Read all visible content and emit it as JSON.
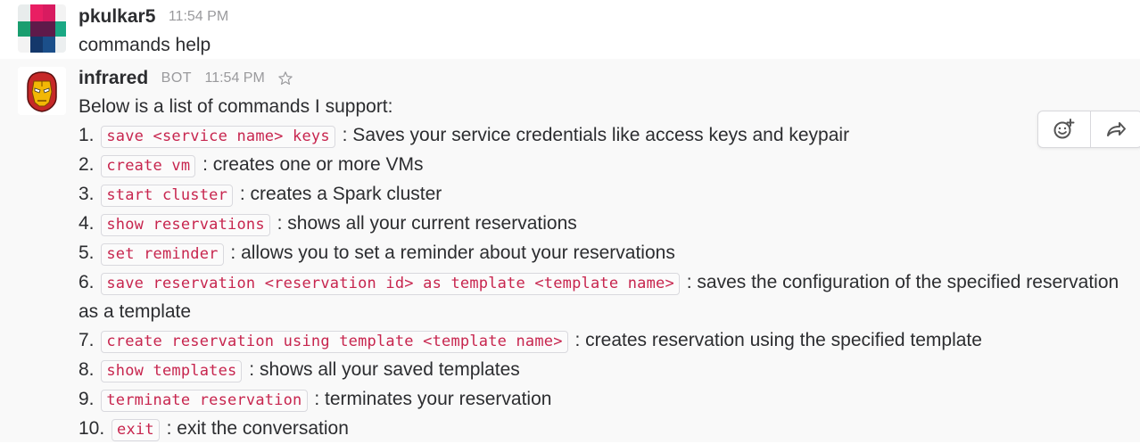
{
  "messages": [
    {
      "sender": "pkulkar5",
      "time": "11:54 PM",
      "text": "commands help",
      "avatar_icon": "colorful-grid-avatar"
    },
    {
      "sender": "infrared",
      "bot_label": "BOT",
      "time": "11:54 PM",
      "avatar_icon": "iron-man-avatar",
      "intro": "Below is a list of commands I support:",
      "commands": [
        {
          "num": "1.",
          "code": "save <service name> keys",
          "desc": ": Saves your service credentials like access keys and keypair"
        },
        {
          "num": "2.",
          "code": "create vm",
          "desc": ": creates one or more VMs"
        },
        {
          "num": "3.",
          "code": "start cluster",
          "desc": ": creates a Spark cluster"
        },
        {
          "num": "4.",
          "code": "show reservations",
          "desc": ": shows all your current reservations"
        },
        {
          "num": "5.",
          "code": "set reminder",
          "desc": ": allows you to set a reminder about your reservations"
        },
        {
          "num": "6.",
          "code": "save reservation <reservation id> as template <template name>",
          "desc": ": saves the configuration of the specified reservation as a template"
        },
        {
          "num": "7.",
          "code": "create reservation using template <template name>",
          "desc": ": creates reservation using the specified template"
        },
        {
          "num": "8.",
          "code": "show templates",
          "desc": ": shows all your saved templates"
        },
        {
          "num": "9.",
          "code": "terminate reservation",
          "desc": ": terminates your reservation"
        },
        {
          "num": "10.",
          "code": "exit",
          "desc": ": exit the conversation"
        }
      ]
    }
  ],
  "hover_actions": [
    "add-reaction-icon",
    "share-message-icon"
  ],
  "colors": {
    "code_text": "#c7254e",
    "muted": "#9a9a9d",
    "hover_bg": "#f9f9f9"
  }
}
